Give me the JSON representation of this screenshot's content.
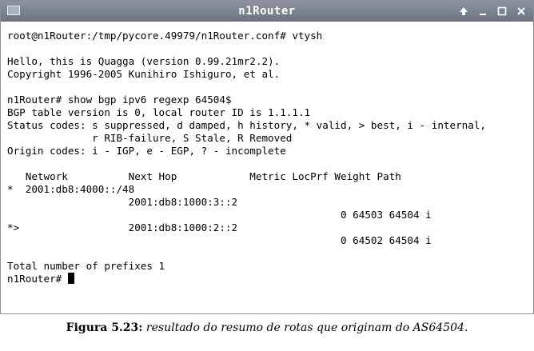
{
  "window": {
    "title": "n1Router",
    "icons": {
      "app": "terminal-window-icon",
      "up": "arrow-up-icon",
      "minimize": "minimize-icon",
      "maximize": "maximize-icon",
      "close": "close-icon"
    }
  },
  "terminal": {
    "lines": [
      "root@n1Router:/tmp/pycore.49979/n1Router.conf# vtysh",
      "",
      "Hello, this is Quagga (version 0.99.21mr2.2).",
      "Copyright 1996-2005 Kunihiro Ishiguro, et al.",
      "",
      "n1Router# show bgp ipv6 regexp 64504$",
      "BGP table version is 0, local router ID is 1.1.1.1",
      "Status codes: s suppressed, d damped, h history, * valid, > best, i - internal,",
      "              r RIB-failure, S Stale, R Removed",
      "Origin codes: i - IGP, e - EGP, ? - incomplete",
      "",
      "   Network          Next Hop            Metric LocPrf Weight Path",
      "*  2001:db8:4000::/48",
      "                    2001:db8:1000:3::2",
      "                                                       0 64503 64504 i",
      "*>                  2001:db8:1000:2::2",
      "                                                       0 64502 64504 i",
      "",
      "Total number of prefixes 1"
    ],
    "prompt": "n1Router# "
  },
  "caption": {
    "label": "Figura 5.23:",
    "text": "resultado do resumo de rotas que originam do AS64504."
  }
}
